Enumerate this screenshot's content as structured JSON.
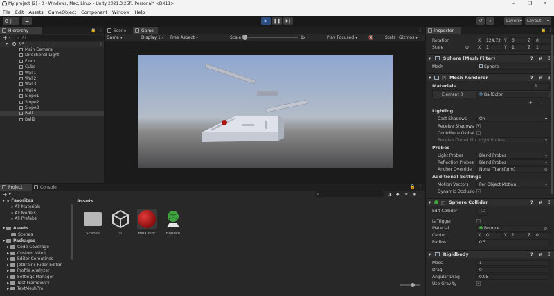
{
  "titlebar": {
    "title": "My project (2) - 0 - Windows, Mac, Linux - Unity 2021.3.25f1 Personal* <DX11>",
    "minimize": "–",
    "maximize": "❐",
    "close": "✕"
  },
  "menu": [
    "File",
    "Edit",
    "Assets",
    "GameObject",
    "Component",
    "Window",
    "Help"
  ],
  "toolbar": {
    "account": "J",
    "layers": "Layers",
    "layout": "Layout"
  },
  "hierarchy": {
    "tab": "Hierarchy",
    "search_placeholder": "All",
    "root": "0*",
    "items": [
      "Main Camera",
      "Directional Light",
      "Floor",
      "Cube",
      "Wall1",
      "Wall2",
      "Wall3",
      "Wall4",
      "Slope1",
      "Slope2",
      "Slope3",
      "Ball",
      "Ball2"
    ],
    "selected": "Ball"
  },
  "view": {
    "tabs": [
      "Scene",
      "Game"
    ],
    "display": "Game",
    "display_num": "Display 1",
    "aspect": "Free Aspect",
    "scale_label": "Scale",
    "scale_value": "1x",
    "focus": "Play Focused",
    "stats": "Stats",
    "gizmos": "Gizmos"
  },
  "project": {
    "tabs": [
      "Project",
      "Console"
    ],
    "favorites": "Favorites",
    "fav_items": [
      "All Materials",
      "All Models",
      "All Prefabs"
    ],
    "assets": "Assets",
    "asset_tree": [
      "Scenes"
    ],
    "packages": "Packages",
    "package_items": [
      "Code Coverage",
      "Custom NUnit",
      "Editor Coroutines",
      "JetBrains Rider Editor",
      "Profile Analyzer",
      "Settings Manager",
      "Test Framework",
      "TextMeshPro"
    ],
    "breadcrumb": "Assets",
    "tiles": [
      "Scenes",
      "0",
      "BallColor",
      "Bounce"
    ]
  },
  "inspector": {
    "tab": "Inspector",
    "rotation_label": "Rotation",
    "rotation": {
      "x": "124.72",
      "y": "0",
      "z": "0"
    },
    "scale_label": "Scale",
    "scale": {
      "x": "1",
      "y": "1",
      "z": "1"
    },
    "mesh_filter": {
      "title": "Sphere (Mesh Filter)",
      "mesh_label": "Mesh",
      "mesh": "Sphere"
    },
    "mesh_renderer": {
      "title": "Mesh Renderer",
      "materials": "Materials",
      "materials_count": "1",
      "element0": "Element 0",
      "element0_value": "BallColor",
      "lighting": "Lighting",
      "cast_shadows_label": "Cast Shadows",
      "cast_shadows": "On",
      "receive_shadows": "Receive Shadows",
      "contribute_gi": "Contribute Global I",
      "receive_gi": "Receive Global Illu",
      "receive_gi_value": "Light Probes",
      "probes": "Probes",
      "light_probes_label": "Light Probes",
      "light_probes": "Blend Probes",
      "reflection_probes_label": "Reflection Probes",
      "reflection_probes": "Blend Probes",
      "anchor_label": "Anchor Override",
      "anchor": "None (Transform)",
      "additional": "Additional Settings",
      "motion_label": "Motion Vectors",
      "motion": "Per Object Motion",
      "dynamic_occlusion": "Dynamic Occlusio"
    },
    "sphere_collider": {
      "title": "Sphere Collider",
      "edit_collider": "Edit Collider",
      "is_trigger": "Is Trigger",
      "material_label": "Material",
      "material": "Bounce",
      "center_label": "Center",
      "center": {
        "x": "0",
        "y": "1",
        "z": "0"
      },
      "radius_label": "Radius",
      "radius": "0.5"
    },
    "rigidbody": {
      "title": "Rigidbody",
      "mass_label": "Mass",
      "mass": "1",
      "drag_label": "Drag",
      "drag": "0",
      "angular_label": "Angular Drag",
      "angular": "0.05",
      "gravity_label": "Use Gravity"
    }
  },
  "colors": {
    "play_blue": "#2d4d7c",
    "game_sky_top": "#8ea6d0",
    "game_ground": "#4a4a4c",
    "ball_red": "#b01515",
    "unity_green": "#3fa23f"
  }
}
